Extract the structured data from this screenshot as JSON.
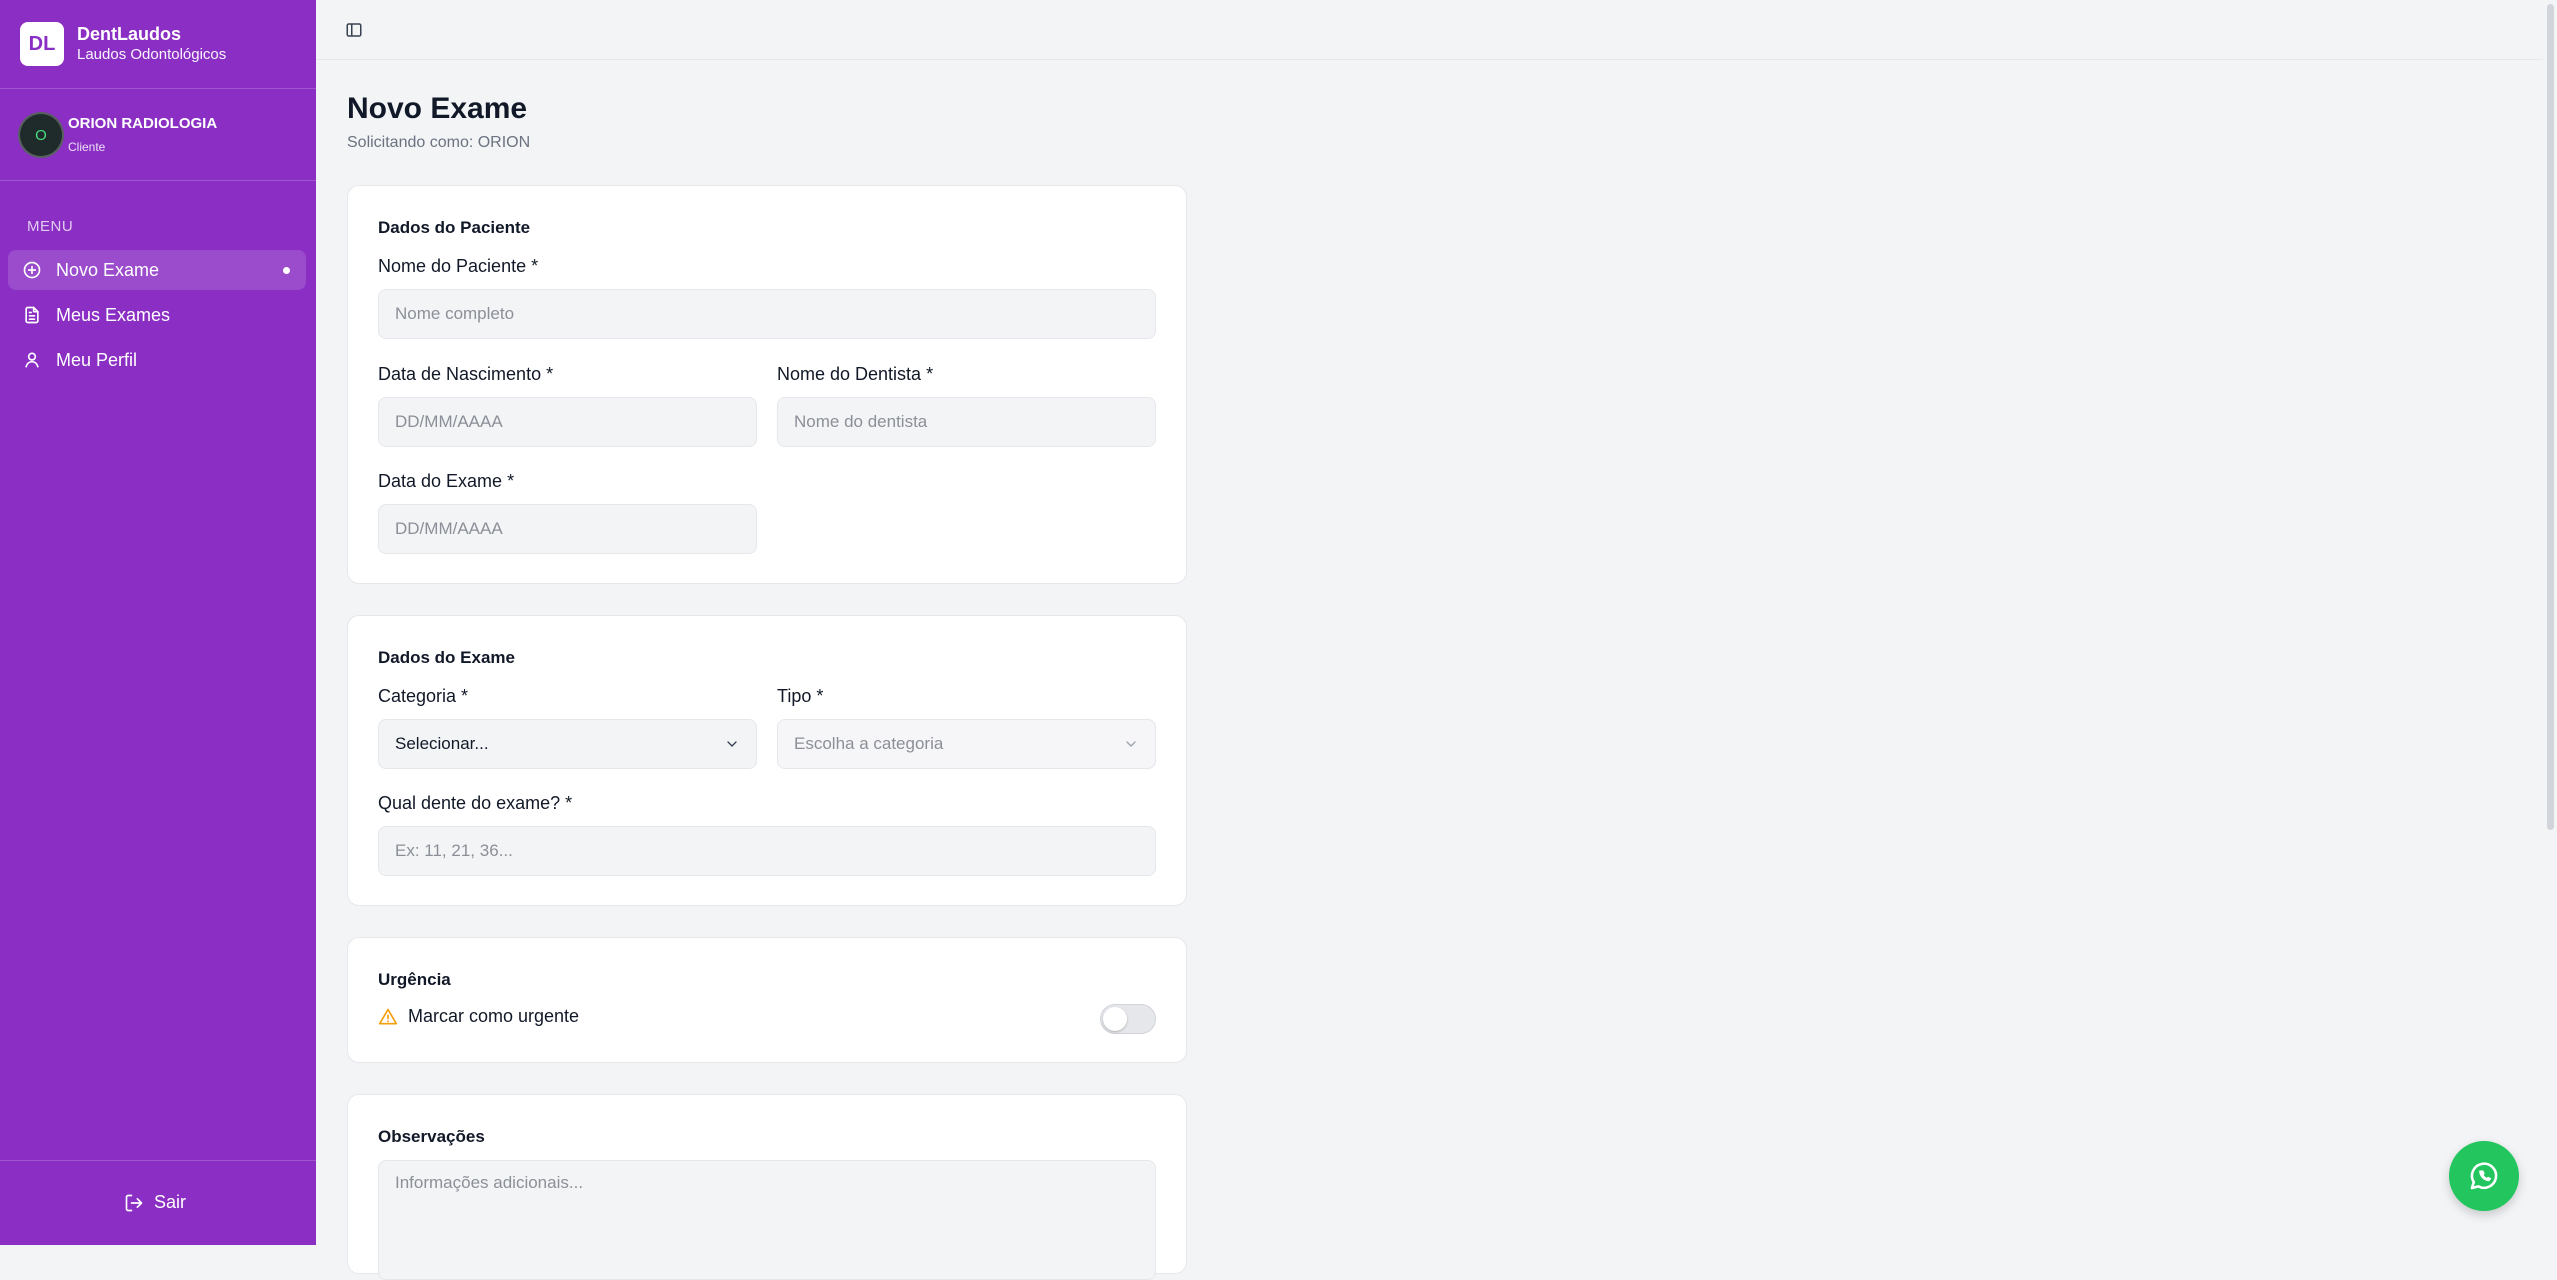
{
  "brand": {
    "logo": "DL",
    "name": "DentLaudos",
    "subtitle": "Laudos Odontológicos"
  },
  "user": {
    "initial": "O",
    "name": "ORION RADIOLOGIA",
    "role": "Cliente"
  },
  "menu": {
    "label": "MENU",
    "items": [
      {
        "label": "Novo Exame",
        "icon": "plus-circle-icon",
        "active": true
      },
      {
        "label": "Meus Exames",
        "icon": "document-icon"
      },
      {
        "label": "Meu Perfil",
        "icon": "user-icon"
      }
    ]
  },
  "logout": {
    "label": "Sair"
  },
  "page": {
    "title": "Novo Exame",
    "subtitle": "Solicitando como: ORION"
  },
  "patient": {
    "section_title": "Dados do Paciente",
    "name_label": "Nome do Paciente *",
    "name_placeholder": "Nome completo",
    "birth_label": "Data de Nascimento *",
    "birth_placeholder": "DD/MM/AAAA",
    "dentist_label": "Nome do Dentista *",
    "dentist_placeholder": "Nome do dentista",
    "exam_date_label": "Data do Exame *",
    "exam_date_placeholder": "DD/MM/AAAA"
  },
  "exam": {
    "section_title": "Dados do Exame",
    "category_label": "Categoria *",
    "category_value": "Selecionar...",
    "type_label": "Tipo *",
    "type_value": "Escolha a categoria",
    "tooth_label": "Qual dente do exame? *",
    "tooth_placeholder": "Ex: 11, 21, 36..."
  },
  "urgency": {
    "section_title": "Urgência",
    "toggle_label": "Marcar como urgente",
    "enabled": false
  },
  "notes": {
    "section_title": "Observações",
    "placeholder": "Informações adicionais..."
  },
  "colors": {
    "sidebar": "#8b2fc4",
    "whatsapp": "#22c55e",
    "warning": "#f59e0b"
  }
}
